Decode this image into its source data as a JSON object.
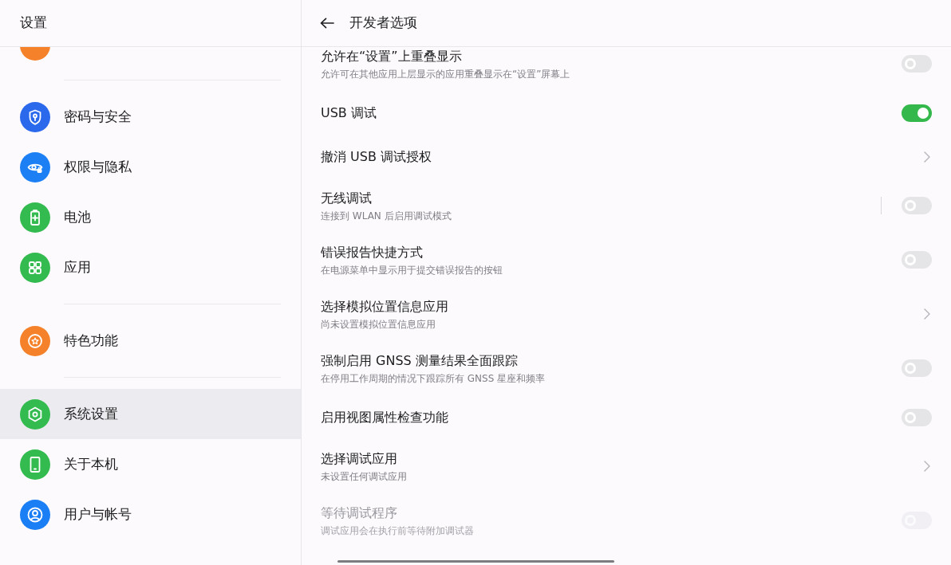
{
  "sidebar": {
    "title": "设置",
    "groups": [
      {
        "items": [
          {
            "color": "#f5822a"
          }
        ]
      },
      {
        "items": [
          {
            "label": "密码与安全",
            "color": "#2a68ec",
            "selected": false
          },
          {
            "label": "权限与隐私",
            "color": "#1d7ff4",
            "selected": false
          },
          {
            "label": "电池",
            "color": "#34bb50",
            "selected": false
          },
          {
            "label": "应用",
            "color": "#34bb50",
            "selected": false
          }
        ]
      },
      {
        "items": [
          {
            "label": "特色功能",
            "color": "#f5822a",
            "selected": false
          }
        ]
      },
      {
        "items": [
          {
            "label": "系统设置",
            "color": "#34bb50",
            "selected": true
          },
          {
            "label": "关于本机",
            "color": "#34bb50",
            "selected": false
          },
          {
            "label": "用户与帐号",
            "color": "#1a7ef5",
            "selected": false
          }
        ]
      }
    ]
  },
  "developer_options": {
    "title": "开发者选项",
    "items": [
      {
        "kind": "switch",
        "title": "允许在“设置”上重叠显示",
        "subtitle": "允许可在其他应用上层显示的应用重叠显示在“设置”屏幕上",
        "on": false,
        "disabled": false
      },
      {
        "kind": "switch",
        "title": "USB 调试",
        "on": true,
        "disabled": false
      },
      {
        "kind": "link",
        "title": "撤消 USB 调试授权",
        "disabled": false
      },
      {
        "kind": "split",
        "title": "无线调试",
        "subtitle": "连接到 WLAN 后启用调试模式",
        "on": false,
        "disabled": false
      },
      {
        "kind": "switch",
        "title": "错误报告快捷方式",
        "subtitle": "在电源菜单中显示用于提交错误报告的按钮",
        "on": false,
        "disabled": false
      },
      {
        "kind": "link",
        "title": "选择模拟位置信息应用",
        "subtitle": "尚未设置模拟位置信息应用",
        "disabled": false
      },
      {
        "kind": "switch",
        "title": "强制启用 GNSS 测量结果全面跟踪",
        "subtitle": "在停用工作周期的情况下跟踪所有 GNSS 星座和频率",
        "on": false,
        "disabled": false
      },
      {
        "kind": "switch",
        "title": "启用视图属性检查功能",
        "on": false,
        "disabled": false
      },
      {
        "kind": "link",
        "title": "选择调试应用",
        "subtitle": "未设置任何调试应用",
        "disabled": false
      },
      {
        "kind": "switch",
        "title": "等待调试程序",
        "subtitle": "调试应用会在执行前等待附加调试器",
        "on": false,
        "disabled": true
      }
    ]
  }
}
